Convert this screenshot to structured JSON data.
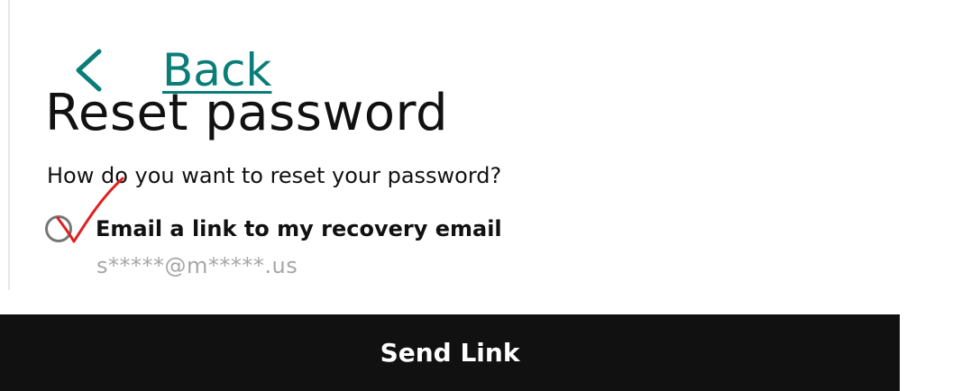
{
  "back": {
    "label": "Back",
    "icon": "chevron-left-icon"
  },
  "title": "Reset password",
  "question": "How do you want to reset your password?",
  "options": [
    {
      "label": "Email a link to my recovery email",
      "detail": "s*****@m*****.us"
    }
  ],
  "annotation": {
    "icon": "checkmark-icon",
    "color": "#e02020"
  },
  "colors": {
    "link": "#0a7d78",
    "button_bg": "#111111",
    "button_text": "#ffffff",
    "muted_text": "#a6a6a6"
  },
  "send_button": {
    "label": "Send Link"
  }
}
